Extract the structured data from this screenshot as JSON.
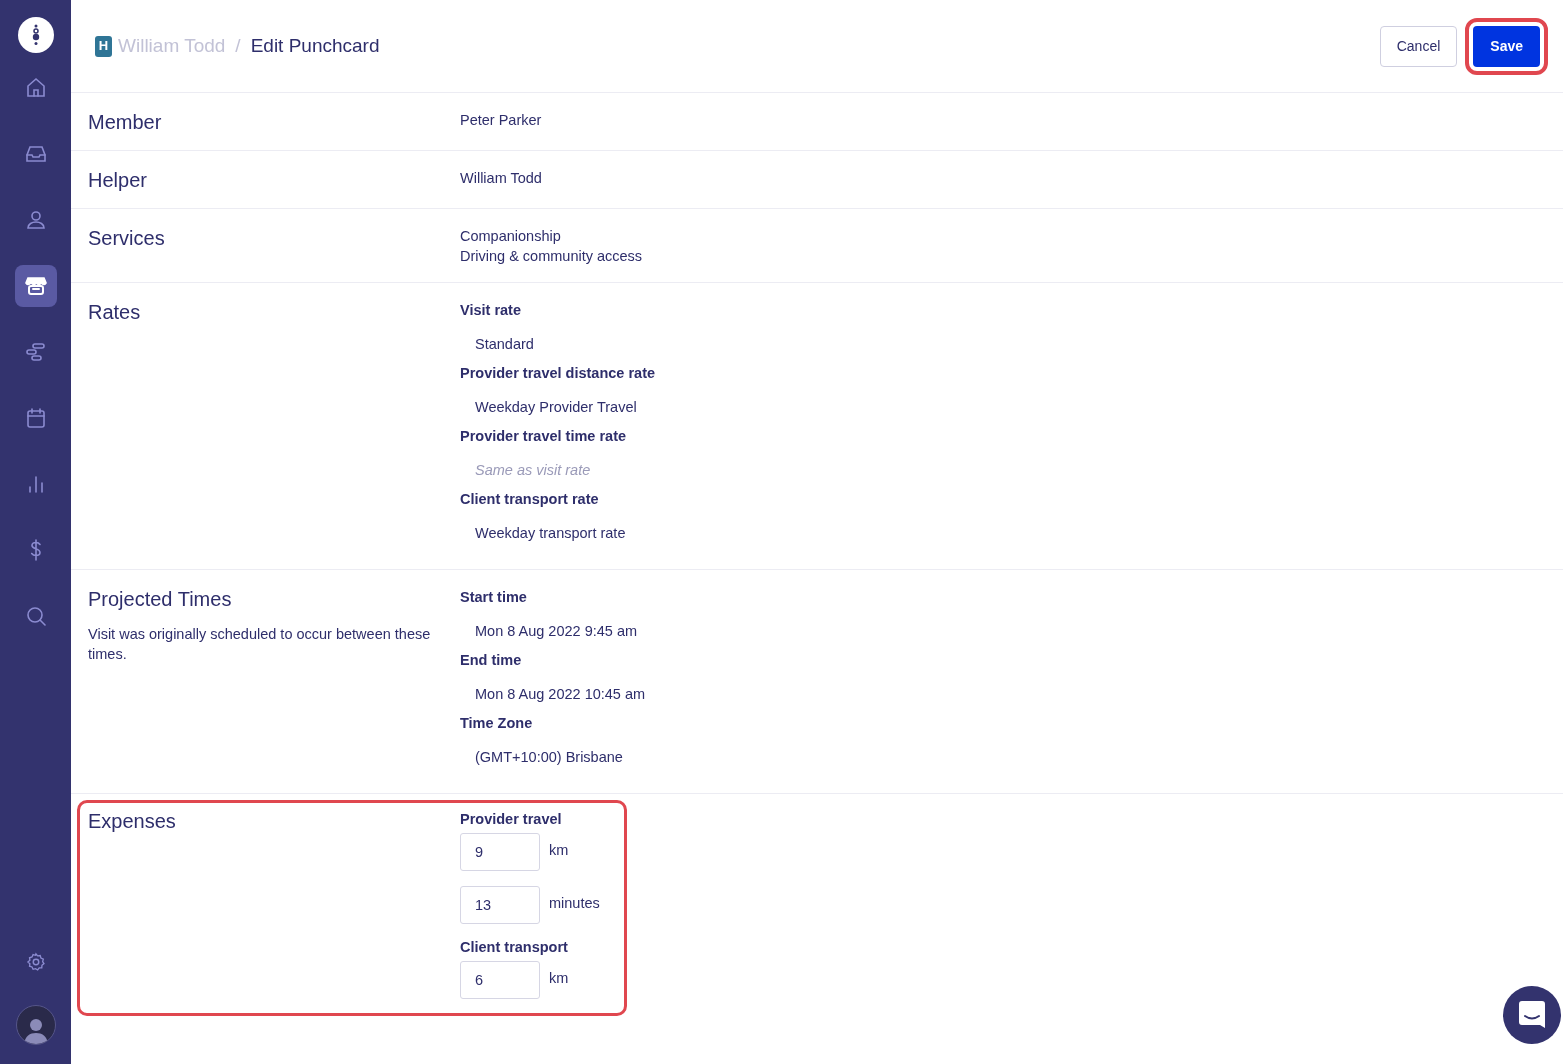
{
  "sidebar": {
    "items": [
      {
        "kind": "home",
        "selected": false
      },
      {
        "kind": "inbox",
        "selected": false
      },
      {
        "kind": "person",
        "selected": false
      },
      {
        "kind": "store",
        "selected": true
      },
      {
        "kind": "timeline",
        "selected": false
      },
      {
        "kind": "calendar",
        "selected": false
      },
      {
        "kind": "chart",
        "selected": false
      },
      {
        "kind": "dollar",
        "selected": false
      },
      {
        "kind": "search",
        "selected": false
      }
    ]
  },
  "header": {
    "badge": "H",
    "breadcrumb": "William Todd",
    "separator": "/",
    "title": "Edit Punchcard",
    "buttons": [
      {
        "label": "Cancel",
        "kind": "secondary"
      },
      {
        "label": "Save",
        "kind": "primary"
      }
    ]
  },
  "sections": [
    {
      "title": "Member",
      "kind": "text",
      "lines": [
        "Peter Parker"
      ]
    },
    {
      "title": "Helper",
      "kind": "text",
      "lines": [
        "William Todd"
      ]
    },
    {
      "title": "Services",
      "kind": "text",
      "lines": [
        "Companionship",
        "Driving & community access"
      ]
    },
    {
      "title": "Rates",
      "kind": "fields",
      "fields": [
        {
          "label": "Visit rate",
          "value": "Standard",
          "muted": false
        },
        {
          "label": "Provider travel distance rate",
          "value": "Weekday Provider Travel",
          "muted": false
        },
        {
          "label": "Provider travel time rate",
          "value": "Same as visit rate",
          "muted": true
        },
        {
          "label": "Client transport rate",
          "value": "Weekday transport rate",
          "muted": false
        }
      ]
    },
    {
      "title": "Projected Times",
      "description": "Visit was originally scheduled to occur between these times.",
      "kind": "fields",
      "fields": [
        {
          "label": "Start time",
          "value": "Mon 8 Aug 2022 9:45 am",
          "muted": false
        },
        {
          "label": "End time",
          "value": "Mon 8 Aug 2022 10:45 am",
          "muted": false
        },
        {
          "label": "Time Zone",
          "value": "(GMT+10:00) Brisbane",
          "muted": false
        }
      ]
    },
    {
      "title": "Expenses",
      "kind": "inputs",
      "groups": [
        {
          "label": "Provider travel",
          "inputs": [
            {
              "value": "9",
              "unit": "km"
            },
            {
              "value": "13",
              "unit": "minutes"
            }
          ]
        },
        {
          "label": "Client transport",
          "inputs": [
            {
              "value": "6",
              "unit": "km"
            }
          ]
        }
      ]
    }
  ]
}
